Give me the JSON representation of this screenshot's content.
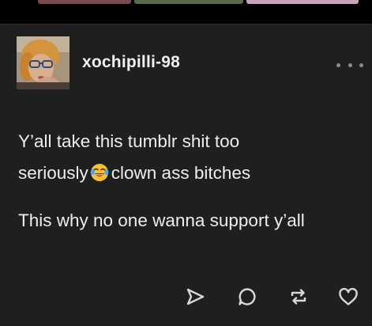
{
  "post": {
    "username": "xochipilli-98",
    "text_line_1a": "Y’all take this tumblr shit too",
    "text_line_1b_before": "seriously",
    "text_line_1b_after": "clown ass bitches",
    "text_paragraph_2": "This why no one wanna support y’all"
  },
  "icons": {
    "emoji": "tears-of-joy-emoji",
    "more": "more-options-icon",
    "share": "send-icon",
    "reply": "comment-icon",
    "reblog": "reblog-icon",
    "like": "heart-icon"
  },
  "colors": {
    "background": "#000000",
    "card": "#1f1f1f",
    "text": "#eeeeee",
    "icon": "#d8d8d8"
  }
}
